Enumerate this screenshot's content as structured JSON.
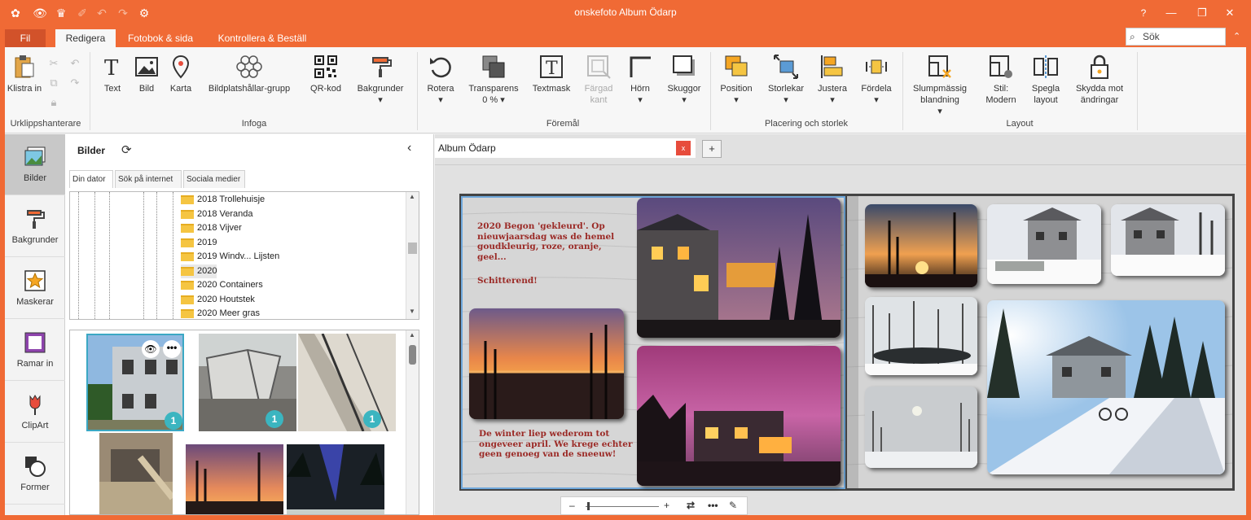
{
  "app": {
    "title": "onskefoto   Album Ödarp"
  },
  "menu_tabs": {
    "fil": "Fil",
    "redigera": "Redigera",
    "fotobok": "Fotobok & sida",
    "kontrollera": "Kontrollera & Beställ"
  },
  "search": {
    "placeholder": "Sök"
  },
  "ribbon": {
    "klistra_in": "Klistra in",
    "urklipp_group": "Urklippshanterare",
    "text": "Text",
    "bild": "Bild",
    "karta": "Karta",
    "bildplats": "Bildplatshållar-grupp",
    "qr": "QR-kod",
    "bakgrunder": "Bakgrunder",
    "infoga_group": "Infoga",
    "rotera": "Rotera",
    "transparens": "Transparens",
    "transparens_val": "0 %",
    "textmask": "Textmask",
    "fargad_kant": "Färgad kant",
    "horn": "Hörn",
    "skuggor": "Skuggor",
    "foremal_group": "Föremål",
    "position": "Position",
    "storlekar": "Storlekar",
    "justera": "Justera",
    "fordela": "Fördela",
    "placering_group": "Placering och storlek",
    "slump": "Slumpmässig blandning",
    "stil": "Stil: Modern",
    "spegla": "Spegla layout",
    "skydda": "Skydda mot ändringar",
    "layout_group": "Layout"
  },
  "nav": [
    "Bilder",
    "Bakgrunder",
    "Maskerar",
    "Ramar in",
    "ClipArt",
    "Former"
  ],
  "panel": {
    "title": "Bilder",
    "tabs": [
      "Din dator",
      "Sök på internet",
      "Sociala medier"
    ],
    "folders": [
      "2018 Trollehuisje",
      "2018 Veranda",
      "2018 Vijver",
      "2019",
      "2019 Windv... Lijsten",
      "2020",
      "2020 Containers",
      "2020 Houtstek",
      "2020 Meer gras"
    ],
    "badge": "1"
  },
  "document": {
    "name": "Album Ödarp",
    "close": "x",
    "add": "+"
  },
  "page_text": {
    "top": "2020 Begon 'gekleurd'. Op nieuwjaarsdag was de hemel goudkleurig, roze, oranje, geel...",
    "top2": "Schitterend!",
    "bottom": "De winter liep wederom tot ongeveer april. We krege echter geen genoeg van de sneeuw!"
  },
  "zoom": {
    "minus": "–",
    "plus": "+"
  }
}
